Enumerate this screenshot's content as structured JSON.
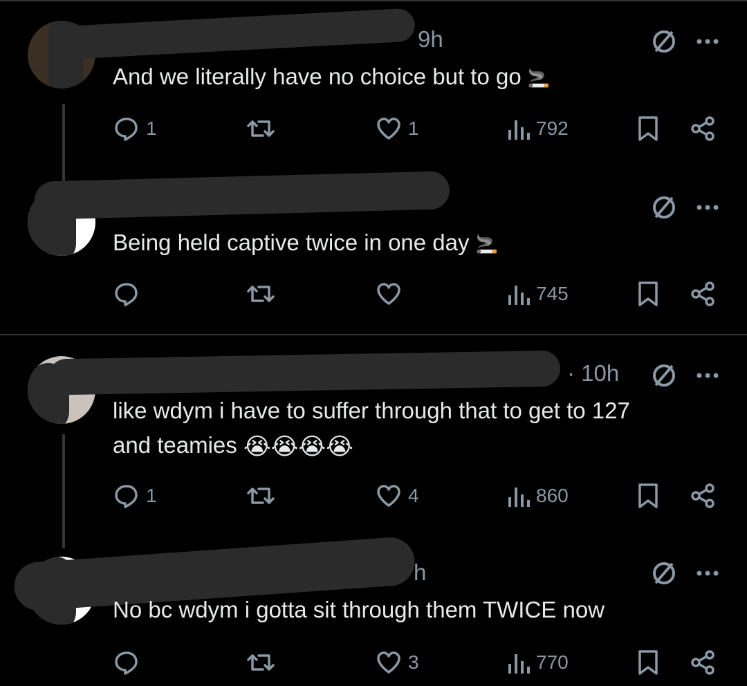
{
  "posts": [
    {
      "time": "9h",
      "text": "And we literally have no choice but to go",
      "emoji": "🚬",
      "replies": "1",
      "reposts": "",
      "likes": "1",
      "views": "792"
    },
    {
      "time": "",
      "text": "Being held captive twice in one day",
      "emoji": "🚬",
      "replies": "",
      "reposts": "",
      "likes": "",
      "views": "745"
    },
    {
      "time": "· 10h",
      "text_line1": "like wdym i have to suffer through that to get to 127",
      "text_line2": "and teamies",
      "emoji": "😭😭😭😭",
      "replies": "1",
      "reposts": "",
      "likes": "4",
      "views": "860"
    },
    {
      "time": "h",
      "text": "No bc wdym i gotta sit through them TWICE now",
      "replies": "",
      "reposts": "",
      "likes": "3",
      "views": "770"
    }
  ],
  "icons": {
    "grok": "grok-icon",
    "more": "more-icon",
    "reply": "reply-icon",
    "repost": "repost-icon",
    "like": "like-icon",
    "views": "views-icon",
    "bookmark": "bookmark-icon",
    "share": "share-icon"
  },
  "colors": {
    "background": "#000000",
    "text": "#e7e9ea",
    "muted": "#8b98a5"
  }
}
